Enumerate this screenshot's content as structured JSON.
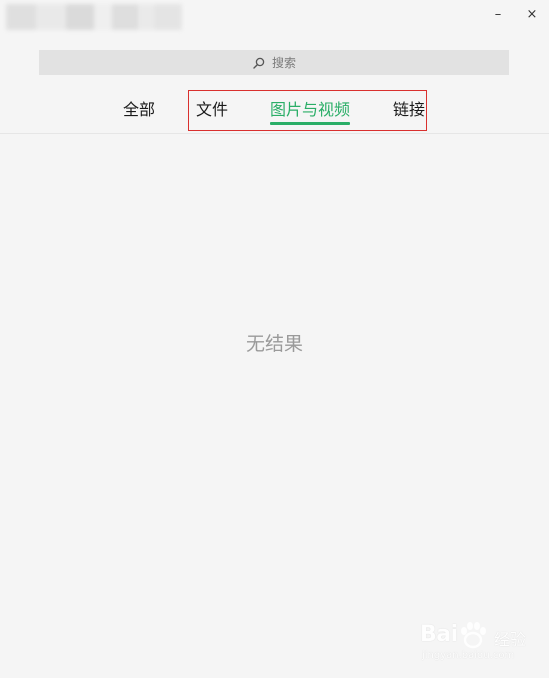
{
  "window": {
    "minimize_glyph": "–",
    "close_glyph": "×"
  },
  "search": {
    "placeholder": "搜索",
    "icon": "search-icon"
  },
  "tabs": [
    {
      "label": "全部",
      "active": false
    },
    {
      "label": "文件",
      "active": false
    },
    {
      "label": "图片与视频",
      "active": true
    },
    {
      "label": "链接",
      "active": false
    }
  ],
  "colors": {
    "active_tab": "#2aae67",
    "highlight_border": "#d9302e",
    "background": "#f5f5f5"
  },
  "results": {
    "empty_text": "无结果"
  },
  "watermark": {
    "logo": "Bai",
    "sub": "经验",
    "url": "jingyan.baidu.com"
  }
}
